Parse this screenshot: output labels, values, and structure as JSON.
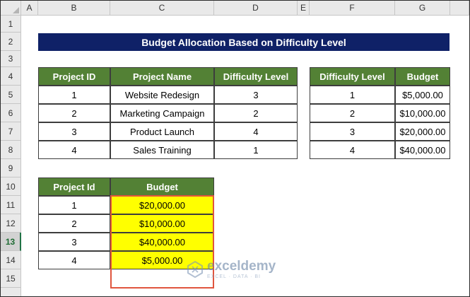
{
  "columns": [
    "A",
    "B",
    "C",
    "D",
    "E",
    "F",
    "G"
  ],
  "rows": [
    "1",
    "2",
    "3",
    "4",
    "5",
    "6",
    "7",
    "8",
    "9",
    "10",
    "11",
    "12",
    "13",
    "14",
    "15"
  ],
  "title": "Budget Allocation Based on Difficulty Level",
  "table1": {
    "headers": [
      "Project ID",
      "Project Name",
      "Difficulty Level"
    ],
    "rows": [
      [
        "1",
        "Website Redesign",
        "3"
      ],
      [
        "2",
        "Marketing Campaign",
        "2"
      ],
      [
        "3",
        "Product Launch",
        "4"
      ],
      [
        "4",
        "Sales Training",
        "1"
      ]
    ]
  },
  "table2": {
    "headers": [
      "Difficulty Level",
      "Budget"
    ],
    "rows": [
      [
        "1",
        "$5,000.00"
      ],
      [
        "2",
        "$10,000.00"
      ],
      [
        "3",
        "$20,000.00"
      ],
      [
        "4",
        "$40,000.00"
      ]
    ]
  },
  "table3": {
    "headers": [
      "Project Id",
      "Budget"
    ],
    "rows": [
      [
        "1",
        "$20,000.00"
      ],
      [
        "2",
        "$10,000.00"
      ],
      [
        "3",
        "$40,000.00"
      ],
      [
        "4",
        "$5,000.00"
      ]
    ]
  },
  "watermark": {
    "name": "exceldemy",
    "tagline": "EXCEL · DATA · BI"
  },
  "colors": {
    "title_bg": "#0f2167",
    "header_bg": "#538135",
    "highlight": "#ffff00",
    "highlight_border": "#e0553e"
  }
}
